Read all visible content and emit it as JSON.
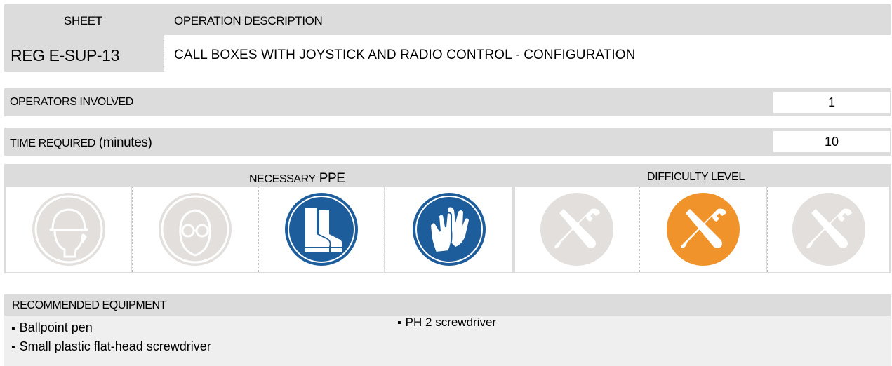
{
  "header": {
    "sheet_label": "SHEET",
    "operation_label": "OPERATION DESCRIPTION",
    "sheet_code": "REG E-SUP-13",
    "operation_description": "CALL BOXES WITH JOYSTICK AND RADIO CONTROL - CONFIGURATION"
  },
  "operators": {
    "label": "OPERATORS INVOLVED",
    "value": "1"
  },
  "time": {
    "label": "TIME REQUIRED",
    "label_suffix": " (minutes)",
    "value": "10"
  },
  "ppe": {
    "label_a": "NECESSARY",
    "label_b": " PPE",
    "icons": [
      {
        "name": "hard-hat-icon",
        "active": false
      },
      {
        "name": "safety-goggles-icon",
        "active": false
      },
      {
        "name": "safety-boots-icon",
        "active": true
      },
      {
        "name": "safety-gloves-icon",
        "active": true
      }
    ]
  },
  "difficulty": {
    "label": "DIFFICULTY LEVEL",
    "levels": [
      {
        "name": "tools-icon",
        "active": false
      },
      {
        "name": "tools-icon",
        "active": true
      },
      {
        "name": "tools-icon",
        "active": false
      }
    ]
  },
  "equipment": {
    "label": "RECOMMENDED EQUIPMENT",
    "items": [
      "Ballpoint pen",
      "Small plastic flat-head screwdriver",
      "PH 2 screwdriver"
    ]
  },
  "colors": {
    "panel_gray": "#dcdcdc",
    "inactive_icon": "#e3dfdc",
    "ppe_blue": "#1d5d9b",
    "difficulty_orange": "#f0932a"
  }
}
